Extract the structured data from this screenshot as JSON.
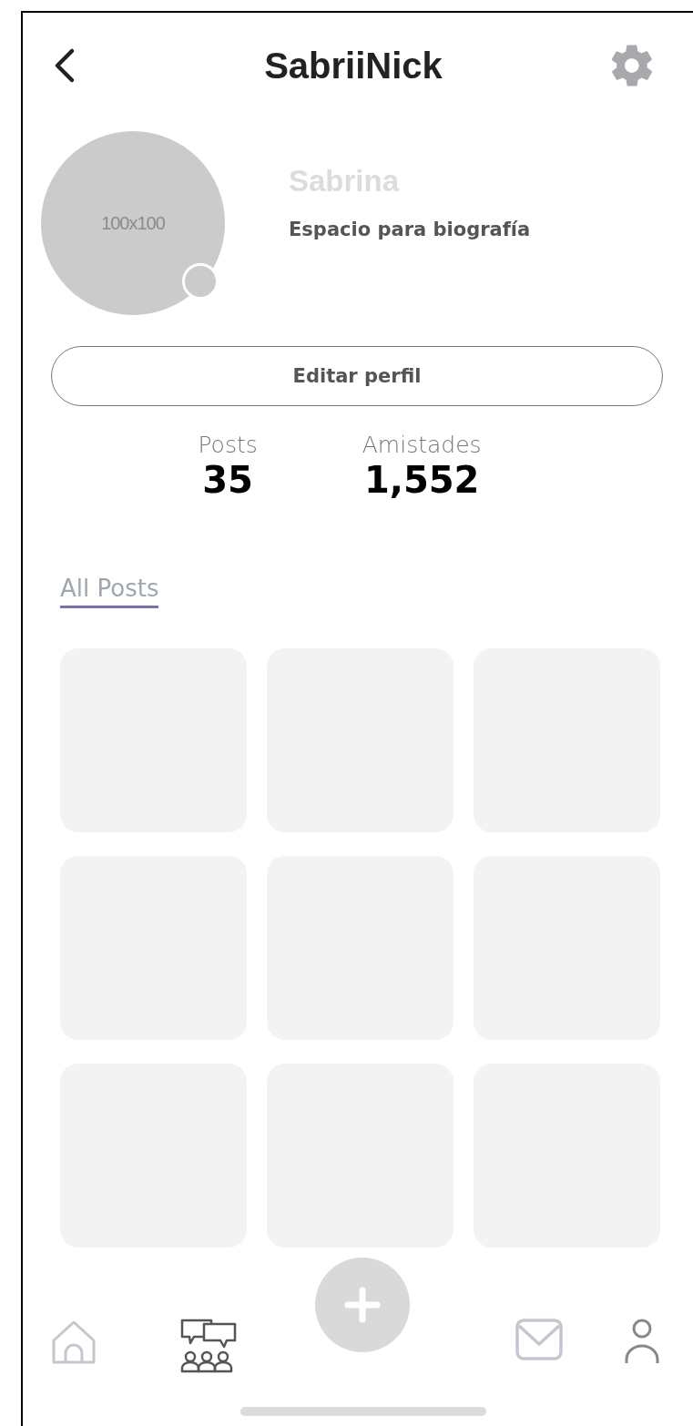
{
  "header": {
    "title": "SabriiNick"
  },
  "profile": {
    "avatar_label": "100x100",
    "name": "Sabrina",
    "bio": "Espacio para biografía"
  },
  "edit_button": "Editar perfil",
  "stats": [
    {
      "label": "Posts",
      "value": "35"
    },
    {
      "label": "Amistades",
      "value": "1,552"
    }
  ],
  "tabs": [
    {
      "label": "All Posts",
      "selected": true
    }
  ],
  "posts": [
    {
      "kind": "placeholder"
    },
    {
      "kind": "placeholder"
    },
    {
      "kind": "placeholder"
    },
    {
      "kind": "placeholder"
    },
    {
      "kind": "placeholder"
    },
    {
      "kind": "placeholder"
    },
    {
      "kind": "placeholder"
    },
    {
      "kind": "placeholder"
    },
    {
      "kind": "placeholder"
    }
  ],
  "nav": [
    {
      "kind": "home",
      "selected": false
    },
    {
      "kind": "community",
      "selected": true
    },
    {
      "kind": "add",
      "selected": false
    },
    {
      "kind": "mail",
      "selected": false
    },
    {
      "kind": "profile",
      "selected": false
    }
  ]
}
